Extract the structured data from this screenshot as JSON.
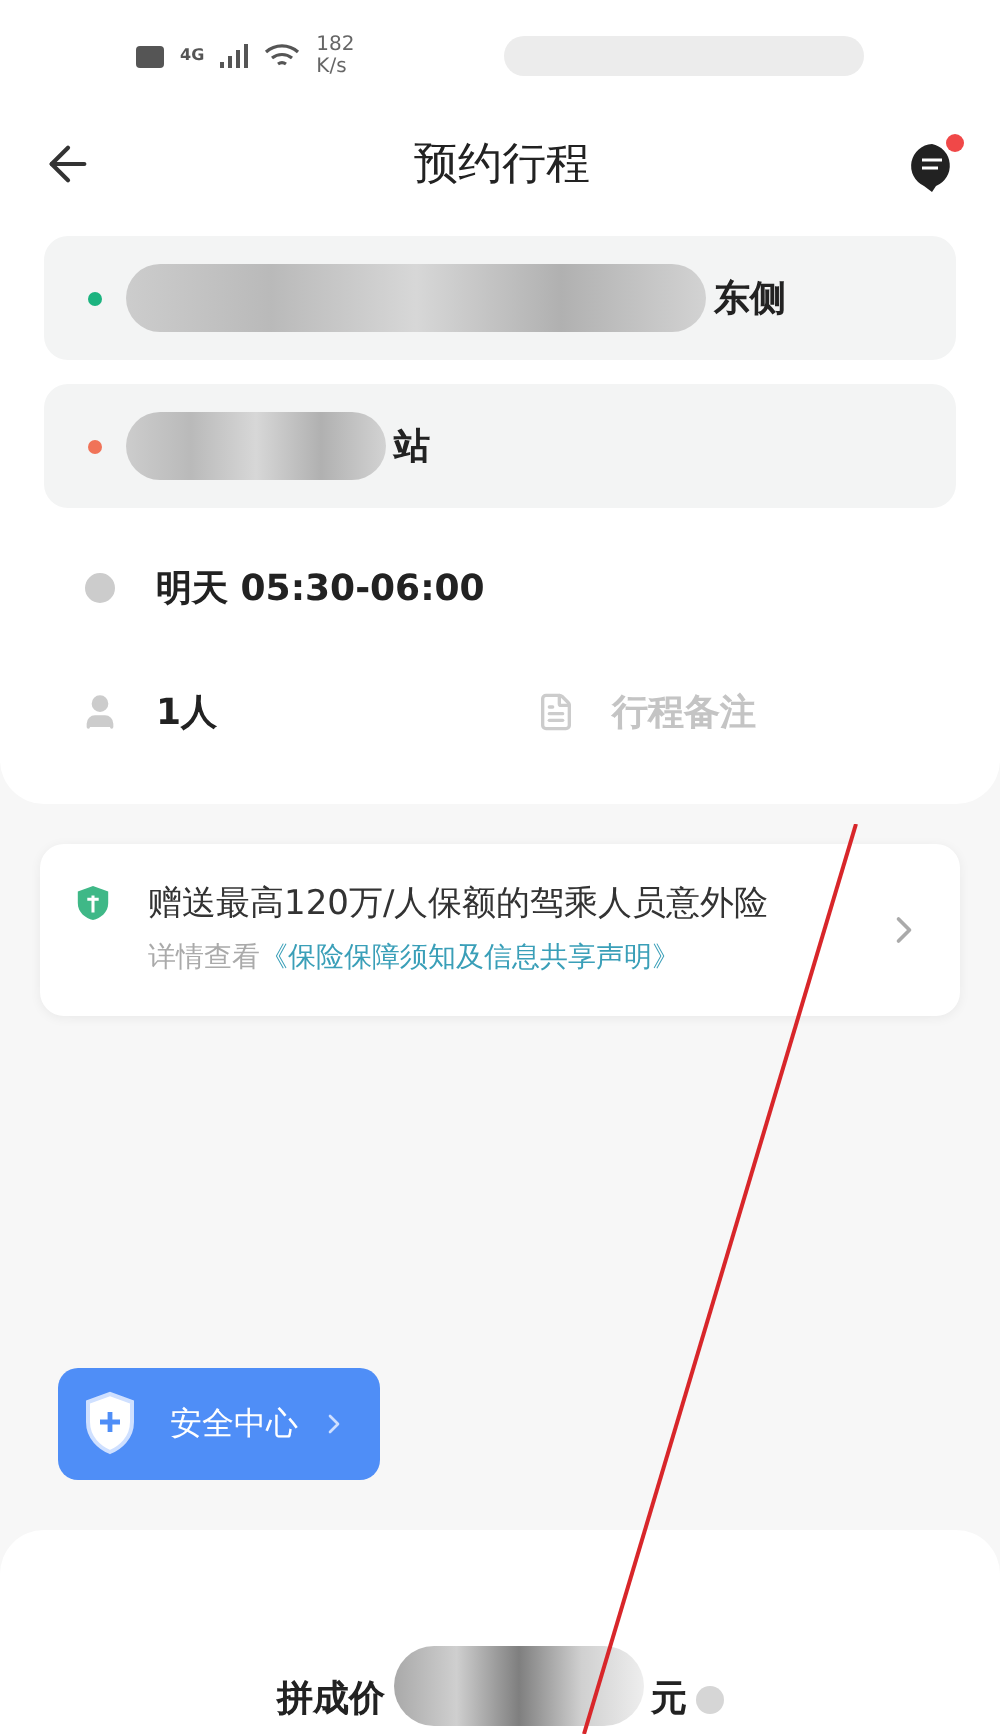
{
  "status_bar": {
    "network": "4G",
    "speed_value": "182",
    "speed_unit": "K/s"
  },
  "header": {
    "title": "预约行程",
    "has_notification": true
  },
  "route": [
    {
      "kind": "origin",
      "visible_text": "东侧",
      "color": "#1bb37f"
    },
    {
      "kind": "destination",
      "visible_text": "站",
      "color": "#f07358"
    }
  ],
  "time": {
    "text": "明天 05:30-06:00"
  },
  "passengers": {
    "text": "1人"
  },
  "note": {
    "placeholder": "行程备注"
  },
  "insurance": {
    "title": "赠送最高120万/人保额的驾乘人员意外险",
    "details_prefix": "详情查看",
    "details_link": "《保险保障须知及信息共享声明》"
  },
  "safety_button": {
    "label": "安全中心"
  },
  "price": {
    "label": "拼成价",
    "unit": "元"
  }
}
